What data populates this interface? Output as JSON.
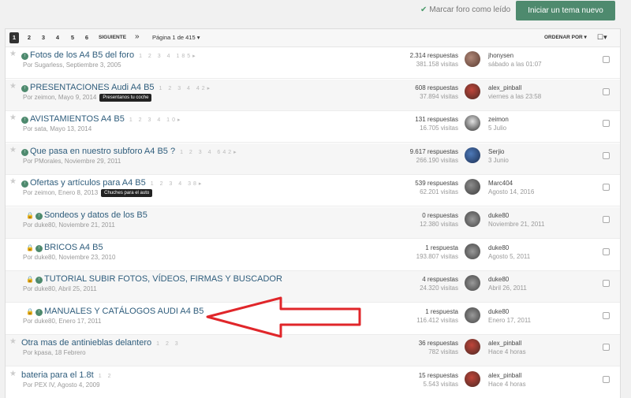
{
  "toolbar": {
    "mark_read_label": "Marcar foro como leído",
    "new_topic_label": "Iniciar un tema nuevo"
  },
  "pagination": {
    "pages": [
      "1",
      "2",
      "3",
      "4",
      "5",
      "6"
    ],
    "active_page": "1",
    "next_label": "SIGUIENTE",
    "last_symbol": "»",
    "page_of_label": "Página 1 de 415 ▾",
    "sort_label": "ORDENAR POR ▾",
    "view_symbol": "☐▾"
  },
  "topics": [
    {
      "title": "Fotos de los A4 B5 del foro",
      "pages": "1 2 3 4 185▸",
      "byline": "Por Sugarless, Septiembre 3, 2005",
      "tag": "",
      "replies": "2.314 respuestas",
      "views": "381.158 visitas",
      "last_user": "jhonysen",
      "last_date": "sábado a las 01:07",
      "locked": false
    },
    {
      "title": "PRESENTACIONES Audi A4 B5",
      "pages": "1 2 3 4 42▸",
      "byline": "Por zeimon, Mayo 9, 2014",
      "tag": "Presentanos tu coche",
      "replies": "608 respuestas",
      "views": "37.894 visitas",
      "last_user": "alex_pinball",
      "last_date": "viernes a las 23:58",
      "locked": false
    },
    {
      "title": "AVISTAMIENTOS A4 B5",
      "pages": "1 2 3 4 10▸",
      "byline": "Por sata, Mayo 13, 2014",
      "tag": "",
      "replies": "131 respuestas",
      "views": "16.705 visitas",
      "last_user": "zeimon",
      "last_date": "5 Julio",
      "locked": false
    },
    {
      "title": "Que pasa en nuestro subforo A4 B5 ?",
      "pages": "1 2 3 4 642▸",
      "byline": "Por PMorales, Noviembre 29, 2011",
      "tag": "",
      "replies": "9.617 respuestas",
      "views": "266.190 visitas",
      "last_user": "Serjio",
      "last_date": "3 Junio",
      "locked": false
    },
    {
      "title": "Ofertas y artículos para A4 B5",
      "pages": "1 2 3 4 38▸",
      "byline": "Por zeimon, Enero 8, 2013",
      "tag": "Chuches para el auto",
      "replies": "539 respuestas",
      "views": "62.201 visitas",
      "last_user": "Marc404",
      "last_date": "Agosto 14, 2016",
      "locked": false
    },
    {
      "title": "Sondeos y datos de los B5",
      "pages": "",
      "byline": "Por duke80, Noviembre 21, 2011",
      "tag": "",
      "replies": "0 respuestas",
      "views": "12.380 visitas",
      "last_user": "duke80",
      "last_date": "Noviembre 21, 2011",
      "locked": true
    },
    {
      "title": "BRICOS A4 B5",
      "pages": "",
      "byline": "Por duke80, Noviembre 23, 2010",
      "tag": "",
      "replies": "1 respuesta",
      "views": "193.807 visitas",
      "last_user": "duke80",
      "last_date": "Agosto 5, 2011",
      "locked": true
    },
    {
      "title": "TUTORIAL SUBIR FOTOS, VÍDEOS, FIRMAS Y BUSCADOR",
      "pages": "",
      "byline": "Por duke80, Abril 25, 2011",
      "tag": "",
      "replies": "4 respuestas",
      "views": "24.320 visitas",
      "last_user": "duke80",
      "last_date": "Abril 26, 2011",
      "locked": true
    },
    {
      "title": "MANUALES Y CATÁLOGOS AUDI A4 B5",
      "pages": "",
      "byline": "Por duke80, Enero 17, 2011",
      "tag": "",
      "replies": "1 respuesta",
      "views": "116.412 visitas",
      "last_user": "duke80",
      "last_date": "Enero 17, 2011",
      "locked": true
    },
    {
      "title": "Otra mas de antinieblas delantero",
      "pages": "1 2 3",
      "byline": "Por kpasa, 18 Febrero",
      "tag": "",
      "replies": "36 respuestas",
      "views": "782 visitas",
      "last_user": "alex_pinball",
      "last_date": "Hace 4 horas",
      "locked": false
    },
    {
      "title": "bateria para el 1.8t",
      "pages": "1 2",
      "byline": "Por PEX IV, Agosto 4, 2009",
      "tag": "",
      "replies": "15 respuestas",
      "views": "5.543 visitas",
      "last_user": "alex_pinball",
      "last_date": "Hace 4 horas",
      "locked": false
    }
  ],
  "colors": {
    "accent": "#4e8a6e",
    "link": "#2f5d7c",
    "annotation_arrow": "#e0262a"
  },
  "icons": {
    "check": "check-icon",
    "star": "star-icon",
    "lock": "lock-icon",
    "pinned": "pinned-icon"
  }
}
